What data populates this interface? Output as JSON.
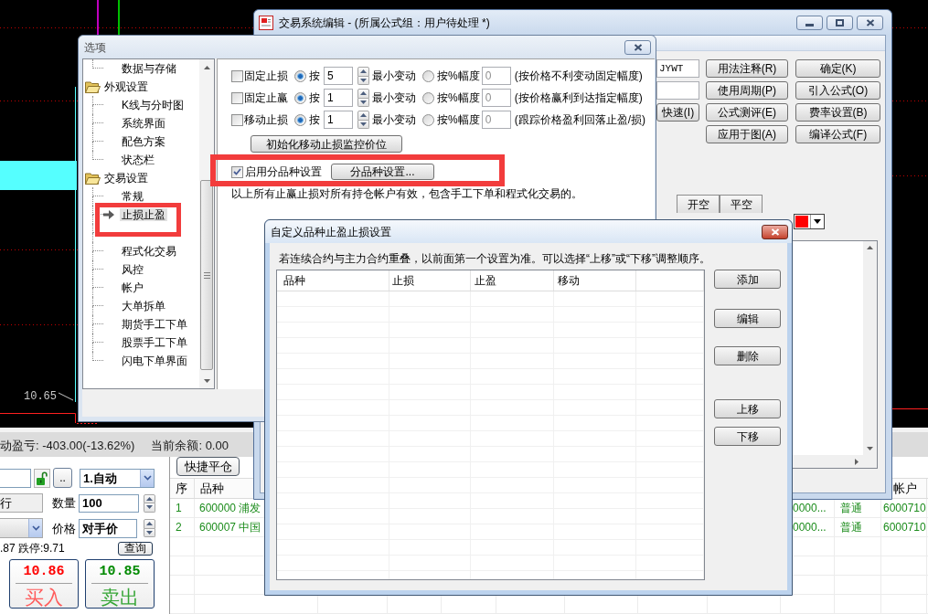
{
  "chart": {
    "price_label": "10.65"
  },
  "status_bar": {
    "items": [
      "动盈亏: -403.00(-13.62%)",
      "当前余额: 0.00"
    ]
  },
  "order_form": {
    "more_button": "..",
    "order_mode": "1.自动",
    "side_field": "行",
    "quantity_label": "数量",
    "quantity": "100",
    "price_label": "价格",
    "price": "对手价",
    "limit_text": ".87 跌停:9.71",
    "query_button": "查询",
    "buy": {
      "price": "10.86",
      "label": "买入"
    },
    "sell": {
      "price": "10.85",
      "label": "卖出"
    }
  },
  "positions": {
    "toolbar": [
      "快捷平仓"
    ],
    "columns": [
      "序",
      "品种",
      "帐户"
    ],
    "rows": [
      {
        "no": "1",
        "symbol": "600000 浦发",
        "column_3": "0000...",
        "column_4": "普通",
        "account": "6000710"
      },
      {
        "no": "2",
        "symbol": "600007 中国",
        "column_3": "0000...",
        "column_4": "普通",
        "account": "6000710"
      }
    ]
  },
  "trading_system_window": {
    "title": "交易系统编辑 - (所属公式组：用户待处理 *)",
    "name_field": "JYWT",
    "side_button": "快速(I)",
    "buttons": [
      "用法注释(R)",
      "确定(K)",
      "使用周期(P)",
      "引入公式(O)",
      "公式测评(E)",
      "费率设置(B)",
      "应用于图(A)",
      "编译公式(F)"
    ],
    "tabs": [
      {
        "label": "开空",
        "selected": false
      },
      {
        "label": "平空",
        "selected": false
      }
    ]
  },
  "options_dialog": {
    "title": "选项",
    "tree": [
      {
        "children": [
          {
            "label": "数据与存储",
            "selected": false
          }
        ]
      },
      {
        "label": "外观设置",
        "expanded": true,
        "children": [
          {
            "label": "K线与分时图",
            "selected": false
          },
          {
            "label": "系统界面",
            "selected": false
          },
          {
            "label": "配色方案",
            "selected": false
          },
          {
            "label": "状态栏",
            "selected": false
          }
        ]
      },
      {
        "label": "交易设置",
        "expanded": true,
        "children": [
          {
            "label": "常规",
            "selected": false
          },
          {
            "label": "止损止盈",
            "selected": true
          },
          {
            "selected": false
          },
          {
            "label": "程式化交易",
            "selected": false
          },
          {
            "label": "风控",
            "selected": false
          },
          {
            "label": "帐户",
            "selected": false
          },
          {
            "label": "大单拆单",
            "selected": false
          },
          {
            "label": "期货手工下单",
            "selected": false
          },
          {
            "label": "股票手工下单",
            "selected": false
          },
          {
            "label": "闪电下单界面",
            "selected": false
          }
        ]
      }
    ],
    "stop_rows": [
      {
        "enabled": false,
        "label": "固定止损",
        "options": [
          {
            "label": "按",
            "selected": true,
            "disabled": false,
            "value": "5",
            "unit": "最小变动"
          },
          {
            "label": "按%幅度",
            "selected": false,
            "disabled": true,
            "value": "0"
          }
        ],
        "note": "(按价格不利变动固定幅度)"
      },
      {
        "enabled": false,
        "label": "固定止赢",
        "options": [
          {
            "label": "按",
            "selected": true,
            "disabled": false,
            "value": "1",
            "unit": "最小变动"
          },
          {
            "label": "按%幅度",
            "selected": false,
            "disabled": true,
            "value": "0"
          }
        ],
        "note": "(按价格赢利到达指定幅度)"
      },
      {
        "enabled": false,
        "label": "移动止损",
        "options": [
          {
            "label": "按",
            "selected": true,
            "disabled": false,
            "value": "1",
            "unit": "最小变动"
          },
          {
            "label": "按%幅度",
            "selected": false,
            "disabled": true,
            "value": "0"
          }
        ],
        "note": "(跟踪价格盈利回落止盈/损)"
      }
    ],
    "init_button": "初始化移动止损监控价位",
    "per_symbol": {
      "checked": true,
      "label": "启用分品种设置",
      "button": "分品种设置..."
    },
    "note": "以上所有止赢止损对所有持仓帐户有效，包含手工下单和程式化交易的。"
  },
  "custom_dialog": {
    "title": "自定义品种止盈止损设置",
    "hint": "若连续合约与主力合约重叠，以前面第一个设置为准。可以选择“上移”或“下移”调整顺序。",
    "columns": [
      "品种",
      "止损",
      "止盈",
      "移动"
    ],
    "buttons": [
      "添加",
      "编辑",
      "删除",
      "上移",
      "下移"
    ]
  }
}
